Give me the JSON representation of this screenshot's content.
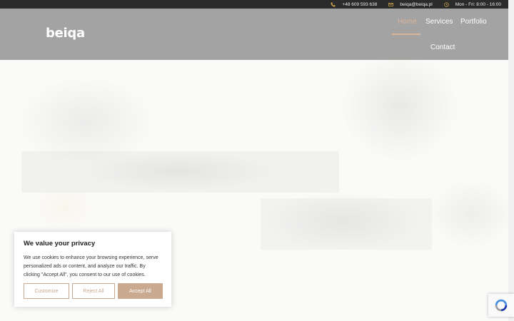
{
  "topbar": {
    "phone": "+48 609 593 638",
    "email": "beiqa@beiqa.pl",
    "hours": "Mon - Fri: 8:00 - 16:00",
    "phone_icon": "phone-icon",
    "email_icon": "envelope-icon",
    "hours_icon": "clock-icon",
    "icon_color": "#d6a94a"
  },
  "header": {
    "logo": "beiqa",
    "nav": {
      "home": "Home",
      "services": "Services",
      "portfolio": "Portfolio",
      "contact": "Contact"
    },
    "active_color": "#d9b59a"
  },
  "cookie": {
    "title": "We value your privacy",
    "text": "We use cookies to enhance your browsing experience, serve personalized ads or content, and analyze our traffic. By clicking \"Accept All\", you consent to our use of cookies.",
    "customize": "Customize",
    "reject": "Reject All",
    "accept": "Accept All",
    "accent_color": "#c9a98f"
  },
  "recaptcha": {
    "icon": "recaptcha-icon"
  }
}
